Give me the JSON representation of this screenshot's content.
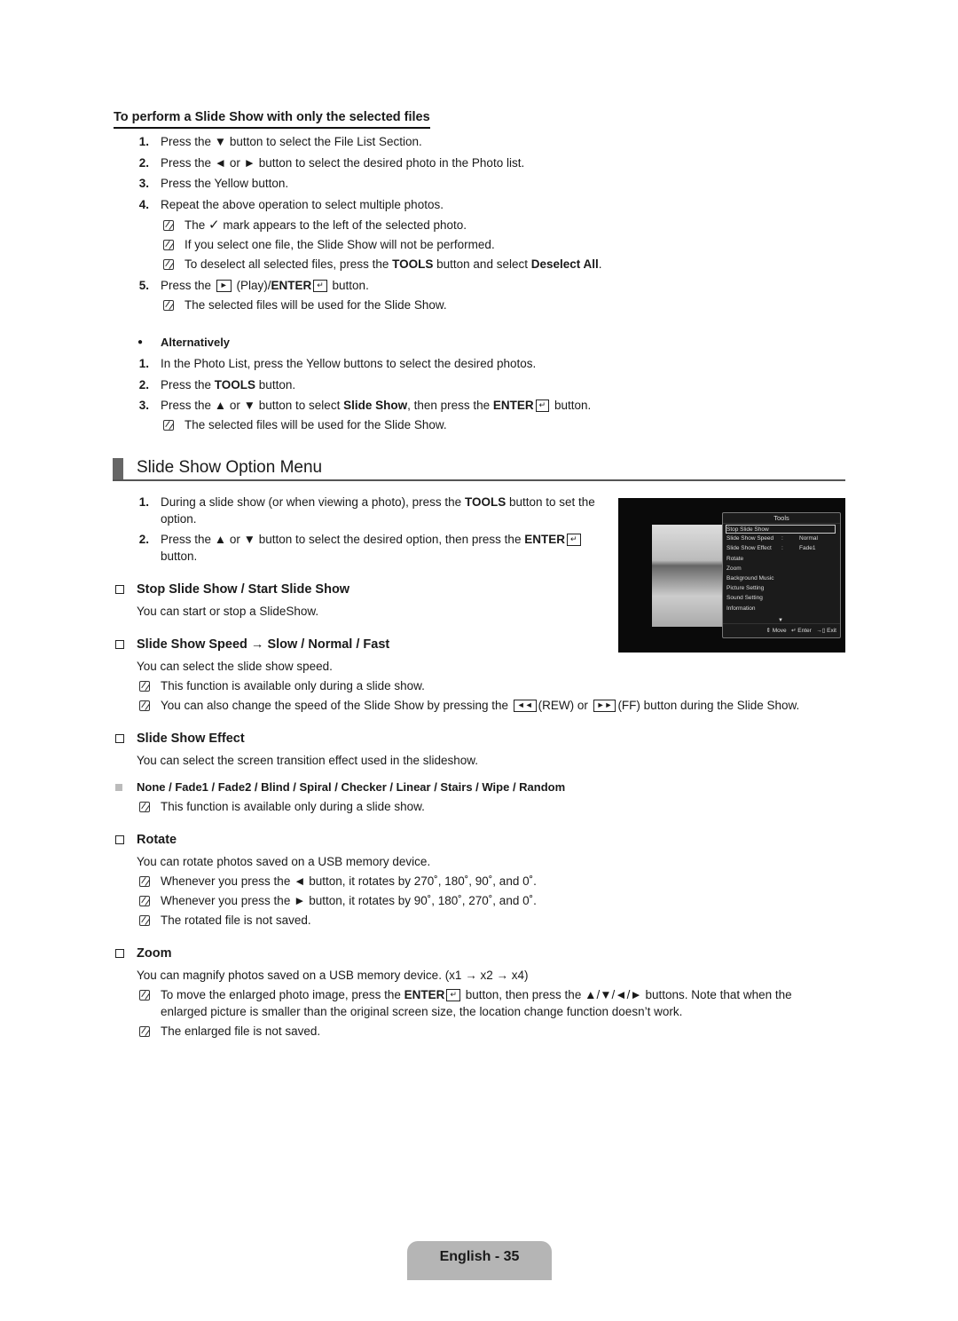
{
  "subsection": {
    "title": "To perform a Slide Show with only the selected files",
    "steps": [
      {
        "n": "1.",
        "text": "Press the ▼ button to select the File List Section."
      },
      {
        "n": "2.",
        "text": "Press the ◄ or ► button to select the desired photo in the Photo list."
      },
      {
        "n": "3.",
        "text": "Press the Yellow button."
      },
      {
        "n": "4.",
        "text": "Repeat the above operation to select multiple photos."
      }
    ],
    "notes4": [
      {
        "pre": "The ",
        "icon": "checkmark-icon",
        "post": " mark appears to the left of the selected photo."
      },
      {
        "text": "If you select one file, the Slide Show will not be performed."
      },
      {
        "pre": "To deselect all selected files, press the ",
        "bold1": "TOOLS",
        "mid": " button and select ",
        "bold2": "Deselect All",
        "post": "."
      }
    ],
    "step5": {
      "n": "5.",
      "pre": "Press the ",
      "icon": "play-icon",
      "mid": " (Play)/",
      "bold": "ENTER",
      "post": " button."
    },
    "note5": "The selected files will be used for the Slide Show.",
    "alt_heading": "Alternatively",
    "alt_steps": [
      {
        "n": "1.",
        "text": "In the Photo List, press the Yellow buttons to select the desired photos."
      },
      {
        "n": "2.",
        "pre": "Press the ",
        "bold": "TOOLS",
        "post": " button."
      },
      {
        "n": "3.",
        "pre": "Press the ▲ or ▼ button to select ",
        "bold": "Slide Show",
        "mid": ", then press the ",
        "bold2": "ENTER",
        "post": " button."
      }
    ],
    "alt_note": "The selected files will be used for the Slide Show."
  },
  "section": {
    "title": "Slide Show Option Menu",
    "steps": [
      {
        "n": "1.",
        "pre": "During a slide show (or when viewing a photo), press the ",
        "bold": "TOOLS",
        "post": " button to set the",
        "line2": "option."
      },
      {
        "n": "2.",
        "pre": "Press the ▲ or ▼ button to select the desired option, then press the ",
        "bold": "ENTER",
        "line2": "button."
      }
    ],
    "options": {
      "stop": {
        "title": "Stop Slide Show / Start Slide Show",
        "desc": "You can start or stop a SlideShow."
      },
      "speed": {
        "title": "Slide Show Speed → Slow / Normal / Fast",
        "desc": "You can select the slide show speed.",
        "note1": "This function is available only during a slide show.",
        "note2": {
          "pre": "You can also change the speed of the Slide Show by pressing the ",
          "rew": "(REW) or ",
          "ff": "(FF) button during the Slide Show."
        }
      },
      "effect": {
        "title": "Slide Show Effect",
        "desc": "You can select the screen transition effect used in the slideshow.",
        "values": "None / Fade1 / Fade2 / Blind / Spiral / Checker / Linear / Stairs / Wipe / Random",
        "note": "This function is available only during a slide show."
      },
      "rotate": {
        "title": "Rotate",
        "desc": "You can rotate photos saved on a USB memory device.",
        "notes": [
          "Whenever you press the ◄ button, it rotates by 270˚, 180˚, 90˚, and 0˚.",
          "Whenever you press the ► button, it rotates by 90˚, 180˚, 270˚, and 0˚.",
          "The rotated file is not saved."
        ]
      },
      "zoom": {
        "title": "Zoom",
        "desc": "You can magnify photos saved on a USB memory device. (x1 → x2 → x4)",
        "note1": {
          "pre": "To move the enlarged photo image, press the ",
          "bold": "ENTER",
          "post": " button, then press the ▲/▼/◄/► buttons. Note that when the",
          "line2": "enlarged picture is smaller than the original screen size, the location change function doesn’t work."
        },
        "note2": "The enlarged file is not saved."
      }
    }
  },
  "tv_menu": {
    "title": "Tools",
    "items": [
      {
        "label": "Stop Slide Show",
        "value": "",
        "selected": true
      },
      {
        "label": "Slide Show Speed",
        "value": "Normal"
      },
      {
        "label": "Slide Show Effect",
        "value": "Fade1"
      },
      {
        "label": "Rotate",
        "value": ""
      },
      {
        "label": "Zoom",
        "value": ""
      },
      {
        "label": "Background Music",
        "value": ""
      },
      {
        "label": "Picture Setting",
        "value": ""
      },
      {
        "label": "Sound Setting",
        "value": ""
      },
      {
        "label": "Information",
        "value": ""
      }
    ],
    "footer": {
      "move": "Move",
      "enter": "Enter",
      "exit": "Exit"
    }
  },
  "footer": {
    "page_label": "English - 35"
  }
}
